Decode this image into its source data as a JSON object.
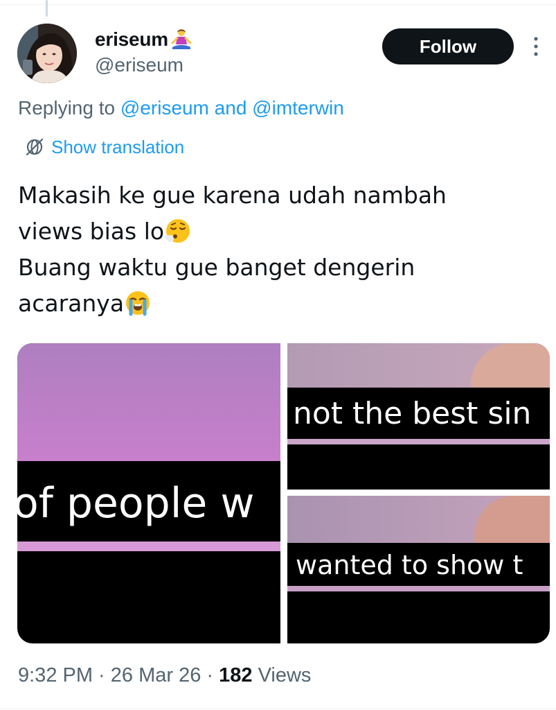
{
  "author": {
    "display_name": "eriseum",
    "name_emoji": "person-in-lotus-position-emoji",
    "handle": "@eriseum",
    "avatar": "profile-photo"
  },
  "follow_label": "Follow",
  "more_icon": "more-vertical-icon",
  "reply_context": {
    "prefix": "Replying to ",
    "mention_1": "@eriseum",
    "conjunction": " and ",
    "mention_2": "@imterwin"
  },
  "translation": {
    "icon": "globe-translate-icon",
    "label": "Show translation"
  },
  "tweet": {
    "line_1": "Makasih ke gue karena udah nambah",
    "line_2": "views bias lo",
    "line_2_emoji": "face-exhaling-emoji",
    "line_3": "Buang waktu gue banget dengerin",
    "line_4": "acaranya",
    "line_4_emoji": "loudly-crying-face-emoji"
  },
  "media": {
    "image_1_caption": "of people w",
    "image_2_caption": "not the best sin",
    "image_3_caption": "wanted to show t"
  },
  "meta": {
    "time": "9:32 PM",
    "separator_1": " · ",
    "date": "26 Mar 26",
    "separator_2": " · ",
    "views_count": "182",
    "views_label": " Views"
  },
  "colors": {
    "link": "#1d9bf0",
    "secondary_text": "#536471",
    "primary_text": "#0f1419",
    "follow_button_bg": "#0f1419",
    "media_purple": "#b57fc2"
  }
}
